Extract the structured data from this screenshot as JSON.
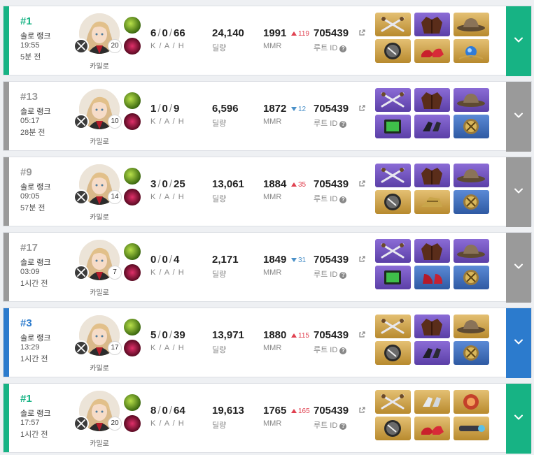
{
  "ui": {
    "kda_label": "K / A / H",
    "damage_label": "딜량",
    "mmr_label": "MMR",
    "route_label": "루트 ID",
    "route_link_icon": "external-link-icon",
    "help_icon": "question-circle-icon",
    "expand_icon": "chevron-down-icon",
    "colors": {
      "win": "#17b384",
      "top3": "#2c7bcd",
      "normal": "#9a9a9a",
      "mmr_up": "#e0404f",
      "mmr_down": "#4a90c8"
    }
  },
  "matches": [
    {
      "rank": "#1",
      "result": "win",
      "mode": "솔로 랭크",
      "duration": "19:55",
      "ago": "5분 전",
      "character": "카밀로",
      "level": "20",
      "kills": "6",
      "assists": "0",
      "hunts": "66",
      "damage": "24,140",
      "mmr": "1991",
      "mmr_delta": "119",
      "mmr_dir": "up",
      "route_id": "705439",
      "items": [
        {
          "icon": "dual-swords-icon",
          "grade": "gold"
        },
        {
          "icon": "jacket-icon",
          "grade": "purple"
        },
        {
          "icon": "hat-icon",
          "grade": "gold"
        },
        {
          "icon": "disc-icon",
          "grade": "gold"
        },
        {
          "icon": "red-shoes-icon",
          "grade": "gold"
        },
        {
          "icon": "blue-gem-icon",
          "grade": "gold"
        }
      ]
    },
    {
      "rank": "#13",
      "result": "normal",
      "mode": "솔로 랭크",
      "duration": "05:17",
      "ago": "28분 전",
      "character": "카밀로",
      "level": "10",
      "kills": "1",
      "assists": "0",
      "hunts": "9",
      "damage": "6,596",
      "mmr": "1872",
      "mmr_delta": "12",
      "mmr_dir": "down",
      "route_id": "705439",
      "items": [
        {
          "icon": "dual-swords-icon",
          "grade": "purple"
        },
        {
          "icon": "jacket-icon",
          "grade": "purple"
        },
        {
          "icon": "hat-icon",
          "grade": "purple"
        },
        {
          "icon": "device-icon",
          "grade": "purple"
        },
        {
          "icon": "gloves-icon",
          "grade": "purple"
        },
        {
          "icon": "emblem-icon",
          "grade": "blue"
        }
      ]
    },
    {
      "rank": "#9",
      "result": "normal",
      "mode": "솔로 랭크",
      "duration": "09:05",
      "ago": "57분 전",
      "character": "카밀로",
      "level": "14",
      "kills": "3",
      "assists": "0",
      "hunts": "25",
      "damage": "13,061",
      "mmr": "1884",
      "mmr_delta": "35",
      "mmr_dir": "up",
      "route_id": "705439",
      "items": [
        {
          "icon": "dual-swords-icon",
          "grade": "purple"
        },
        {
          "icon": "jacket-icon",
          "grade": "purple"
        },
        {
          "icon": "hat-icon",
          "grade": "purple"
        },
        {
          "icon": "disc-icon",
          "grade": "gold"
        },
        {
          "icon": "gauntlet-icon",
          "grade": "gold"
        },
        {
          "icon": "emblem-icon",
          "grade": "blue"
        }
      ]
    },
    {
      "rank": "#17",
      "result": "normal",
      "mode": "솔로 랭크",
      "duration": "03:09",
      "ago": "1시간 전",
      "character": "카밀로",
      "level": "7",
      "kills": "0",
      "assists": "0",
      "hunts": "4",
      "damage": "2,171",
      "mmr": "1849",
      "mmr_delta": "31",
      "mmr_dir": "down",
      "route_id": "705439",
      "items": [
        {
          "icon": "dual-swords-icon",
          "grade": "purple"
        },
        {
          "icon": "jacket-icon",
          "grade": "purple"
        },
        {
          "icon": "hat-icon",
          "grade": "purple"
        },
        {
          "icon": "device-icon",
          "grade": "purple"
        },
        {
          "icon": "heels-icon",
          "grade": "blue"
        },
        {
          "icon": "emblem-icon",
          "grade": "blue"
        }
      ]
    },
    {
      "rank": "#3",
      "result": "top3",
      "mode": "솔로 랭크",
      "duration": "13:29",
      "ago": "1시간 전",
      "character": "카밀로",
      "level": "17",
      "kills": "5",
      "assists": "0",
      "hunts": "39",
      "damage": "13,971",
      "mmr": "1880",
      "mmr_delta": "115",
      "mmr_dir": "up",
      "route_id": "705439",
      "items": [
        {
          "icon": "dual-swords-icon",
          "grade": "gold"
        },
        {
          "icon": "jacket-icon",
          "grade": "purple"
        },
        {
          "icon": "hat-icon",
          "grade": "gold"
        },
        {
          "icon": "disc-icon",
          "grade": "gold"
        },
        {
          "icon": "gloves-icon",
          "grade": "purple"
        },
        {
          "icon": "emblem-icon",
          "grade": "blue"
        }
      ]
    },
    {
      "rank": "#1",
      "result": "win",
      "mode": "솔로 랭크",
      "duration": "17:57",
      "ago": "1시간 전",
      "character": "카밀로",
      "level": "20",
      "kills": "8",
      "assists": "0",
      "hunts": "64",
      "damage": "19,613",
      "mmr": "1765",
      "mmr_delta": "165",
      "mmr_dir": "up",
      "route_id": "705439",
      "items": [
        {
          "icon": "dual-swords-icon",
          "grade": "gold"
        },
        {
          "icon": "white-gloves-icon",
          "grade": "gold"
        },
        {
          "icon": "red-hat-icon",
          "grade": "gold"
        },
        {
          "icon": "disc-icon",
          "grade": "gold"
        },
        {
          "icon": "red-shoes-icon",
          "grade": "gold"
        },
        {
          "icon": "scope-icon",
          "grade": "gold"
        }
      ]
    }
  ]
}
